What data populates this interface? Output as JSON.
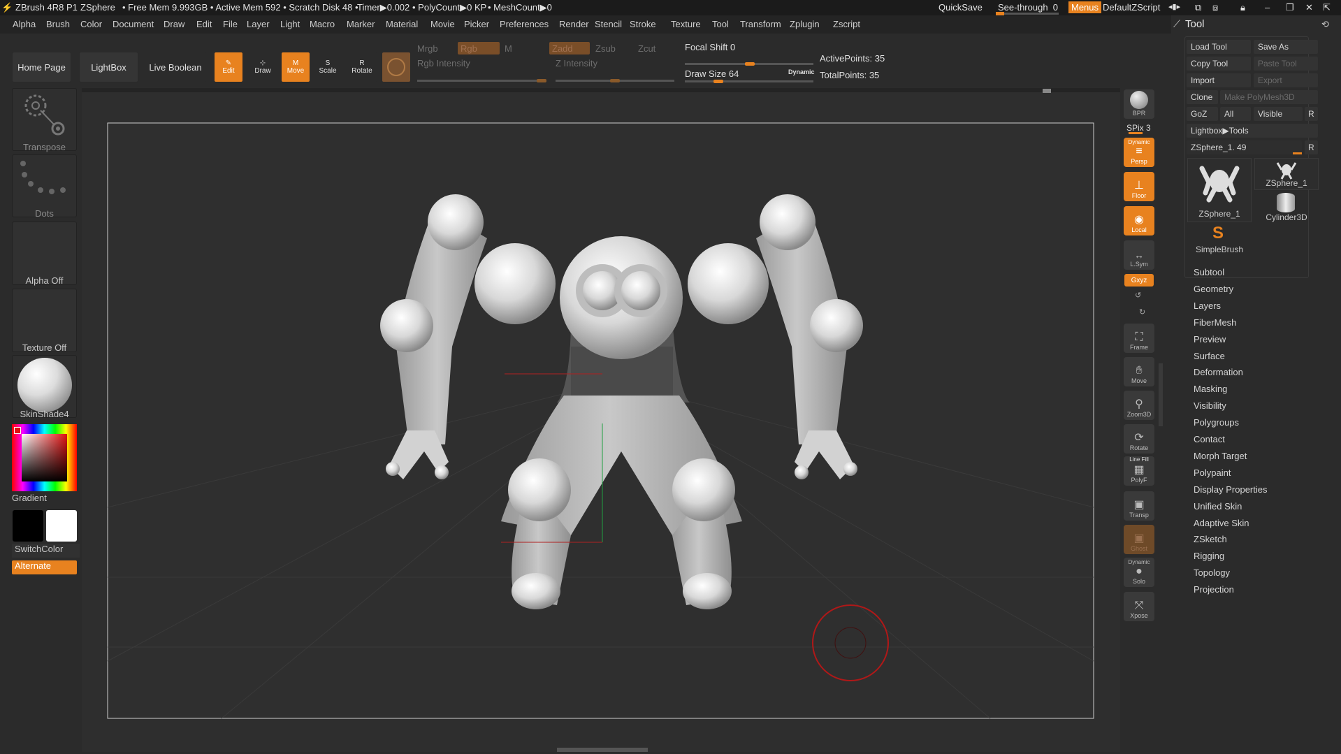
{
  "title_bar": {
    "app_name": "ZBrush 4R8 P1",
    "document": "ZSphere",
    "stats": "• Free Mem 9.993GB • Active Mem 592 • Scratch Disk 48 •",
    "timer": "Timer▶0.002",
    "polycount": "• PolyCount▶0 KP",
    "meshcount": "• MeshCount▶0",
    "quicksave": "QuickSave",
    "see_through": "See-through",
    "see_through_value": "0",
    "menus": "Menus",
    "script": "DefaultZScript"
  },
  "menu": [
    "Alpha",
    "Brush",
    "Color",
    "Document",
    "Draw",
    "Edit",
    "File",
    "Layer",
    "Light",
    "Macro",
    "Marker",
    "Material",
    "Movie",
    "Picker",
    "Preferences",
    "Render",
    "Stencil",
    "Stroke",
    "Texture",
    "Tool",
    "Transform",
    "Zplugin",
    "Zscript"
  ],
  "shelf": {
    "home_page": "Home Page",
    "lightbox": "LightBox",
    "live_boolean": "Live Boolean",
    "edit": "Edit",
    "draw": "Draw",
    "move": "Move",
    "scale": "Scale",
    "rotate": "Rotate",
    "mrgb": "Mrgb",
    "rgb": "Rgb",
    "m": "M",
    "zadd": "Zadd",
    "zsub": "Zsub",
    "zcut": "Zcut",
    "rgb_intensity": "Rgb Intensity",
    "z_intensity": "Z Intensity",
    "focal_shift_label": "Focal Shift",
    "focal_shift_value": "0",
    "draw_size_label": "Draw Size",
    "draw_size_value": "64",
    "dynamic": "Dynamic",
    "active_points": "ActivePoints: 35",
    "total_points": "TotalPoints: 35"
  },
  "left_tray": {
    "transpose": "Transpose",
    "dots": "Dots",
    "alpha": "Alpha Off",
    "texture": "Texture Off",
    "material": "SkinShade4",
    "gradient": "Gradient",
    "switch_color": "SwitchColor",
    "alternate": "Alternate"
  },
  "right_shelf": {
    "bpr": "BPR",
    "spix": "SPix 3",
    "dynamic": "Dynamic",
    "persp": "Persp",
    "floor": "Floor",
    "local": "Local",
    "lsym": "L.Sym",
    "xyz": "Gxyz",
    "frame": "Frame",
    "move": "Move",
    "zoom3d": "Zoom3D",
    "rotate": "Rotate",
    "line_fill": "Line Fill",
    "polyf": "PolyF",
    "transp": "Transp",
    "ghost": "Ghost",
    "dynamic2": "Dynamic",
    "solo": "Solo",
    "xpose": "Xpose"
  },
  "tool_panel": {
    "title": "Tool",
    "load_tool": "Load Tool",
    "save_as": "Save As",
    "copy_tool": "Copy Tool",
    "paste_tool": "Paste Tool",
    "import": "Import",
    "export": "Export",
    "clone": "Clone",
    "make_polymesh": "Make PolyMesh3D",
    "goz": "GoZ",
    "all": "All",
    "visible": "Visible",
    "r": "R",
    "lightbox_tools": "Lightbox▶Tools",
    "current_tool": "ZSphere_1. 49",
    "thumbs": [
      "ZSphere_1",
      "ZSphere_1",
      "Cylinder3D",
      "SimpleBrush"
    ],
    "subpalettes": [
      "Subtool",
      "Geometry",
      "Layers",
      "FiberMesh",
      "Preview",
      "Surface",
      "Deformation",
      "Masking",
      "Visibility",
      "Polygroups",
      "Contact",
      "Morph Target",
      "Polypaint",
      "Display Properties",
      "Unified Skin",
      "Adaptive Skin",
      "ZSketch",
      "Rigging",
      "Topology",
      "Projection"
    ]
  },
  "colors": {
    "accent": "#e8821f",
    "background": "#2b2b2b",
    "model": "#d9d9d9"
  }
}
